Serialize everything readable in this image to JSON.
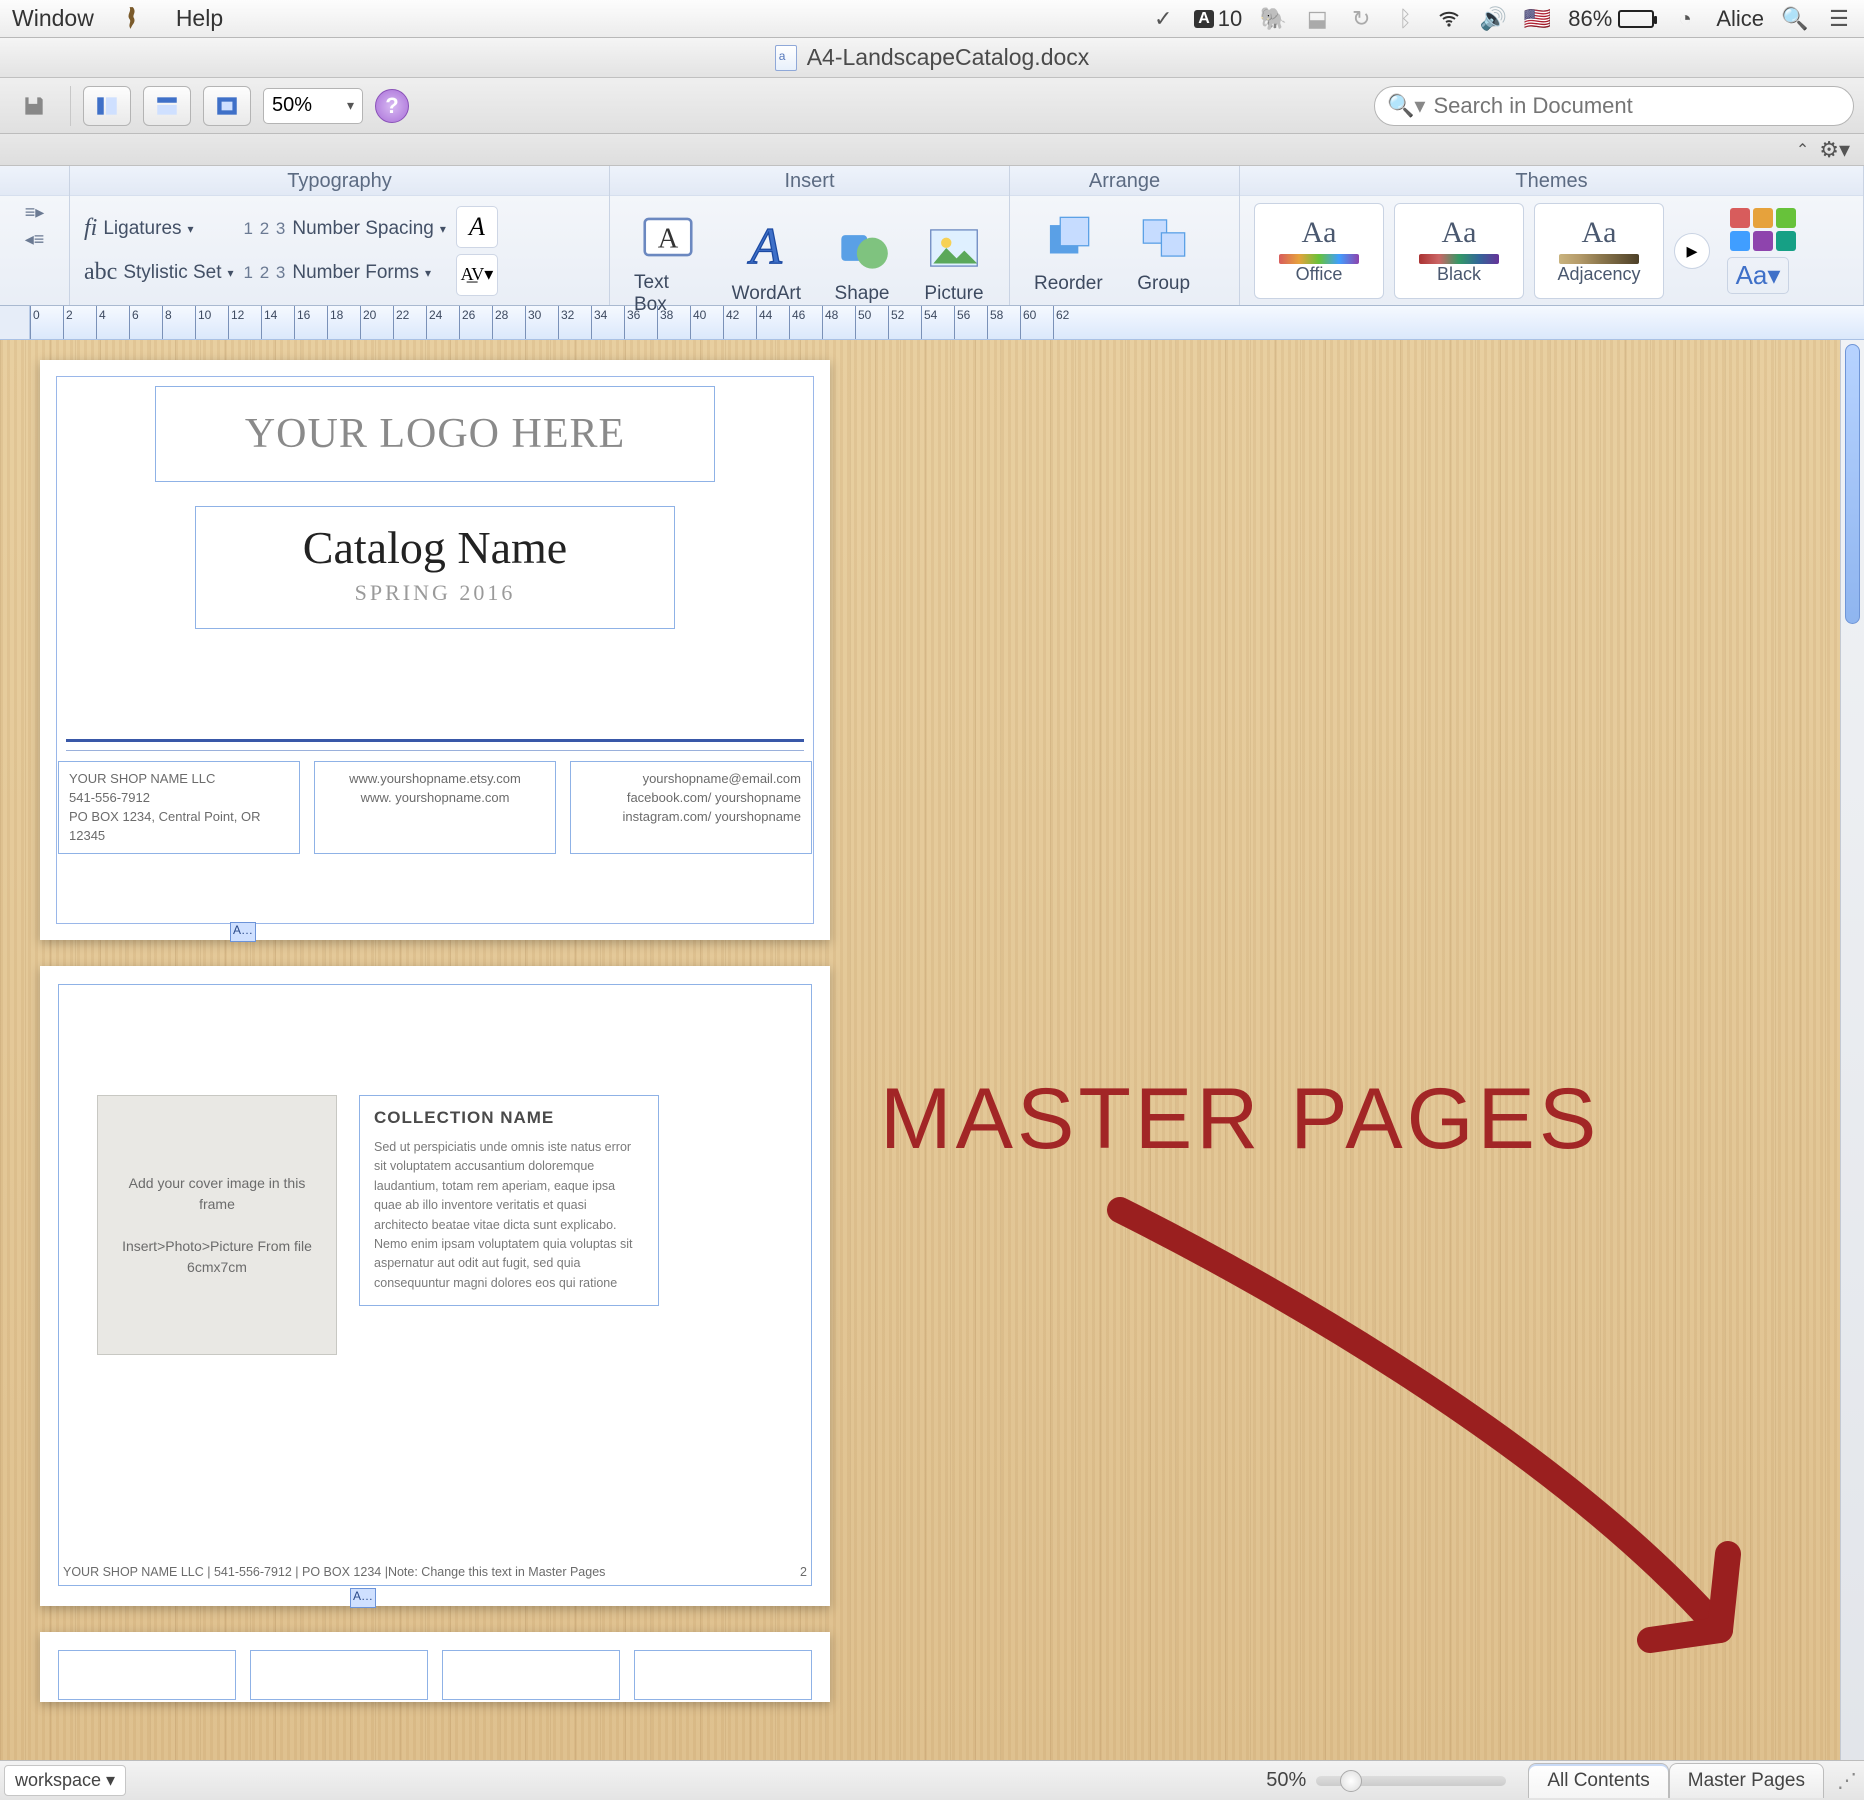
{
  "menubar": {
    "left": [
      "Window",
      "Help"
    ],
    "adobe_count": "10",
    "battery_pct": "86%",
    "user": "Alice"
  },
  "titlebar": {
    "filename": "A4-LandscapeCatalog.docx"
  },
  "qtoolbar": {
    "zoom": "50%",
    "search_placeholder": "Search in Document"
  },
  "ribbon": {
    "groups": {
      "typography": {
        "label": "Typography",
        "ligatures": "Ligatures",
        "numspacing": "Number Spacing",
        "stylset": "Stylistic Set",
        "numforms": "Number Forms"
      },
      "insert": {
        "label": "Insert",
        "textbox": "Text Box",
        "wordart": "WordArt",
        "shape": "Shape",
        "picture": "Picture"
      },
      "arrange": {
        "label": "Arrange",
        "reorder": "Reorder",
        "group": "Group"
      },
      "themes": {
        "label": "Themes",
        "cards": [
          "Office",
          "Black",
          "Adjacency"
        ],
        "Aa": "Aa"
      }
    }
  },
  "ruler": {
    "labels": [
      "0",
      "2",
      "4",
      "6",
      "8",
      "10",
      "12",
      "14",
      "16",
      "18",
      "20",
      "22",
      "24",
      "26",
      "28",
      "30",
      "32",
      "34",
      "36",
      "38",
      "40",
      "42",
      "44",
      "46",
      "48",
      "50",
      "52",
      "54",
      "56",
      "58",
      "60",
      "62"
    ]
  },
  "page1": {
    "logo": "YOUR LOGO HERE",
    "catalog_script": "Catalog Name",
    "season": "SPRING 2016",
    "footer": {
      "c1l1": "YOUR SHOP NAME LLC",
      "c1l2": "541-556-7912",
      "c1l3": "PO BOX 1234, Central Point, OR 12345",
      "c2l1": "www.yourshopname.etsy.com",
      "c2l2": "www. yourshopname.com",
      "c3l1": "yourshopname@email.com",
      "c3l2": "facebook.com/ yourshopname",
      "c3l3": "instagram.com/ yourshopname"
    }
  },
  "page2": {
    "cover_l1": "Add your cover image in this frame",
    "cover_l2": "Insert>Photo>Picture From file",
    "cover_l3": "6cmx7cm",
    "coll_head": "COLLECTION NAME",
    "coll_body": "Sed ut perspiciatis unde omnis iste natus error sit voluptatem accusantium doloremque laudantium, totam rem aperiam, eaque ipsa quae ab illo inventore veritatis et quasi architecto beatae vitae dicta sunt explicabo. Nemo enim ipsam voluptatem quia voluptas sit aspernatur aut odit aut fugit, sed quia consequuntur magni dolores eos qui ratione",
    "foot_left": "YOUR SHOP NAME LLC | 541-556-7912 | PO BOX 1234 |Note: Change this text in Master Pages",
    "foot_page": "2"
  },
  "overlay": {
    "title": "MASTER PAGES"
  },
  "status": {
    "workspace": "workspace ▾",
    "zoom": "50%",
    "tabs": [
      "All Contents",
      "Master Pages"
    ]
  }
}
